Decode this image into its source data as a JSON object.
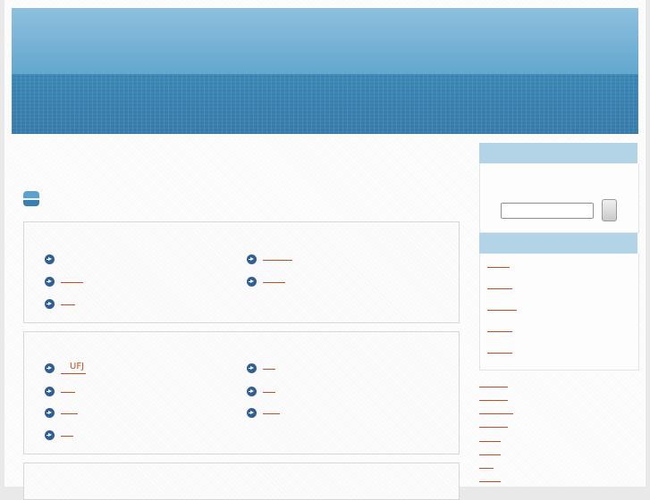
{
  "header": {
    "banner_top_color": "#8fc0de",
    "banner_bottom_color": "#3a7fac"
  },
  "main": {
    "section_icon": "section-badge-icon",
    "box1": {
      "links": [
        {
          "label": ""
        },
        {
          "label": ""
        },
        {
          "label": ""
        },
        {
          "label": ""
        },
        {
          "label": ""
        }
      ]
    },
    "box2": {
      "links": [
        {
          "label": "UFJ"
        },
        {
          "label": ""
        },
        {
          "label": ""
        },
        {
          "label": ""
        },
        {
          "label": ""
        },
        {
          "label": ""
        },
        {
          "label": ""
        }
      ]
    }
  },
  "sidebar": {
    "search": {
      "value": "",
      "placeholder": "",
      "button_label": ""
    },
    "links": [
      {
        "label": ""
      },
      {
        "label": ""
      },
      {
        "label": ""
      },
      {
        "label": ""
      },
      {
        "label": ""
      }
    ],
    "more_links": [
      {
        "label": ""
      },
      {
        "label": ""
      },
      {
        "label": ""
      },
      {
        "label": ""
      },
      {
        "label": ""
      },
      {
        "label": ""
      },
      {
        "label": ""
      },
      {
        "label": ""
      }
    ]
  },
  "colors": {
    "link": "#c05020",
    "sidebar_header": "#b3d3e7",
    "arrow_icon": "#2f5f93"
  }
}
